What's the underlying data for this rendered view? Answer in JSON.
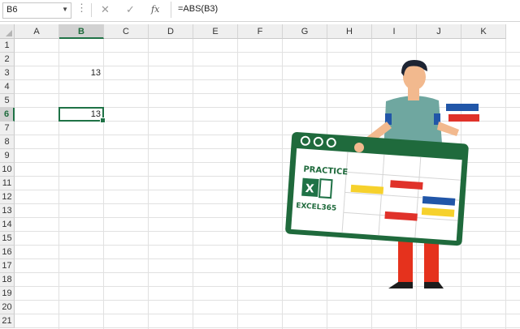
{
  "formula_bar": {
    "name_box": "B6",
    "cancel_icon": "✕",
    "enter_icon": "✓",
    "fx_label": "fx",
    "formula": "=ABS(B3)"
  },
  "columns": [
    "A",
    "B",
    "C",
    "D",
    "E",
    "F",
    "G",
    "H",
    "I",
    "J",
    "K"
  ],
  "rows": [
    "1",
    "2",
    "3",
    "4",
    "5",
    "6",
    "7",
    "8",
    "9",
    "10",
    "11",
    "12",
    "13",
    "14",
    "15",
    "16",
    "17",
    "18",
    "19",
    "20",
    "21"
  ],
  "selected_cell": "B6",
  "cells": {
    "B3": "13",
    "B6": "13"
  },
  "illustration": {
    "practice_text": "PRACTICE",
    "excel_icon_letter": "X",
    "brand_text": "EXCEL365"
  },
  "colors": {
    "excel_green": "#1f7246",
    "shirt": "#6fa7a0",
    "pants": "#e5321d",
    "yellow": "#f6d12c",
    "blue": "#2156a8",
    "red": "#e0322a"
  }
}
